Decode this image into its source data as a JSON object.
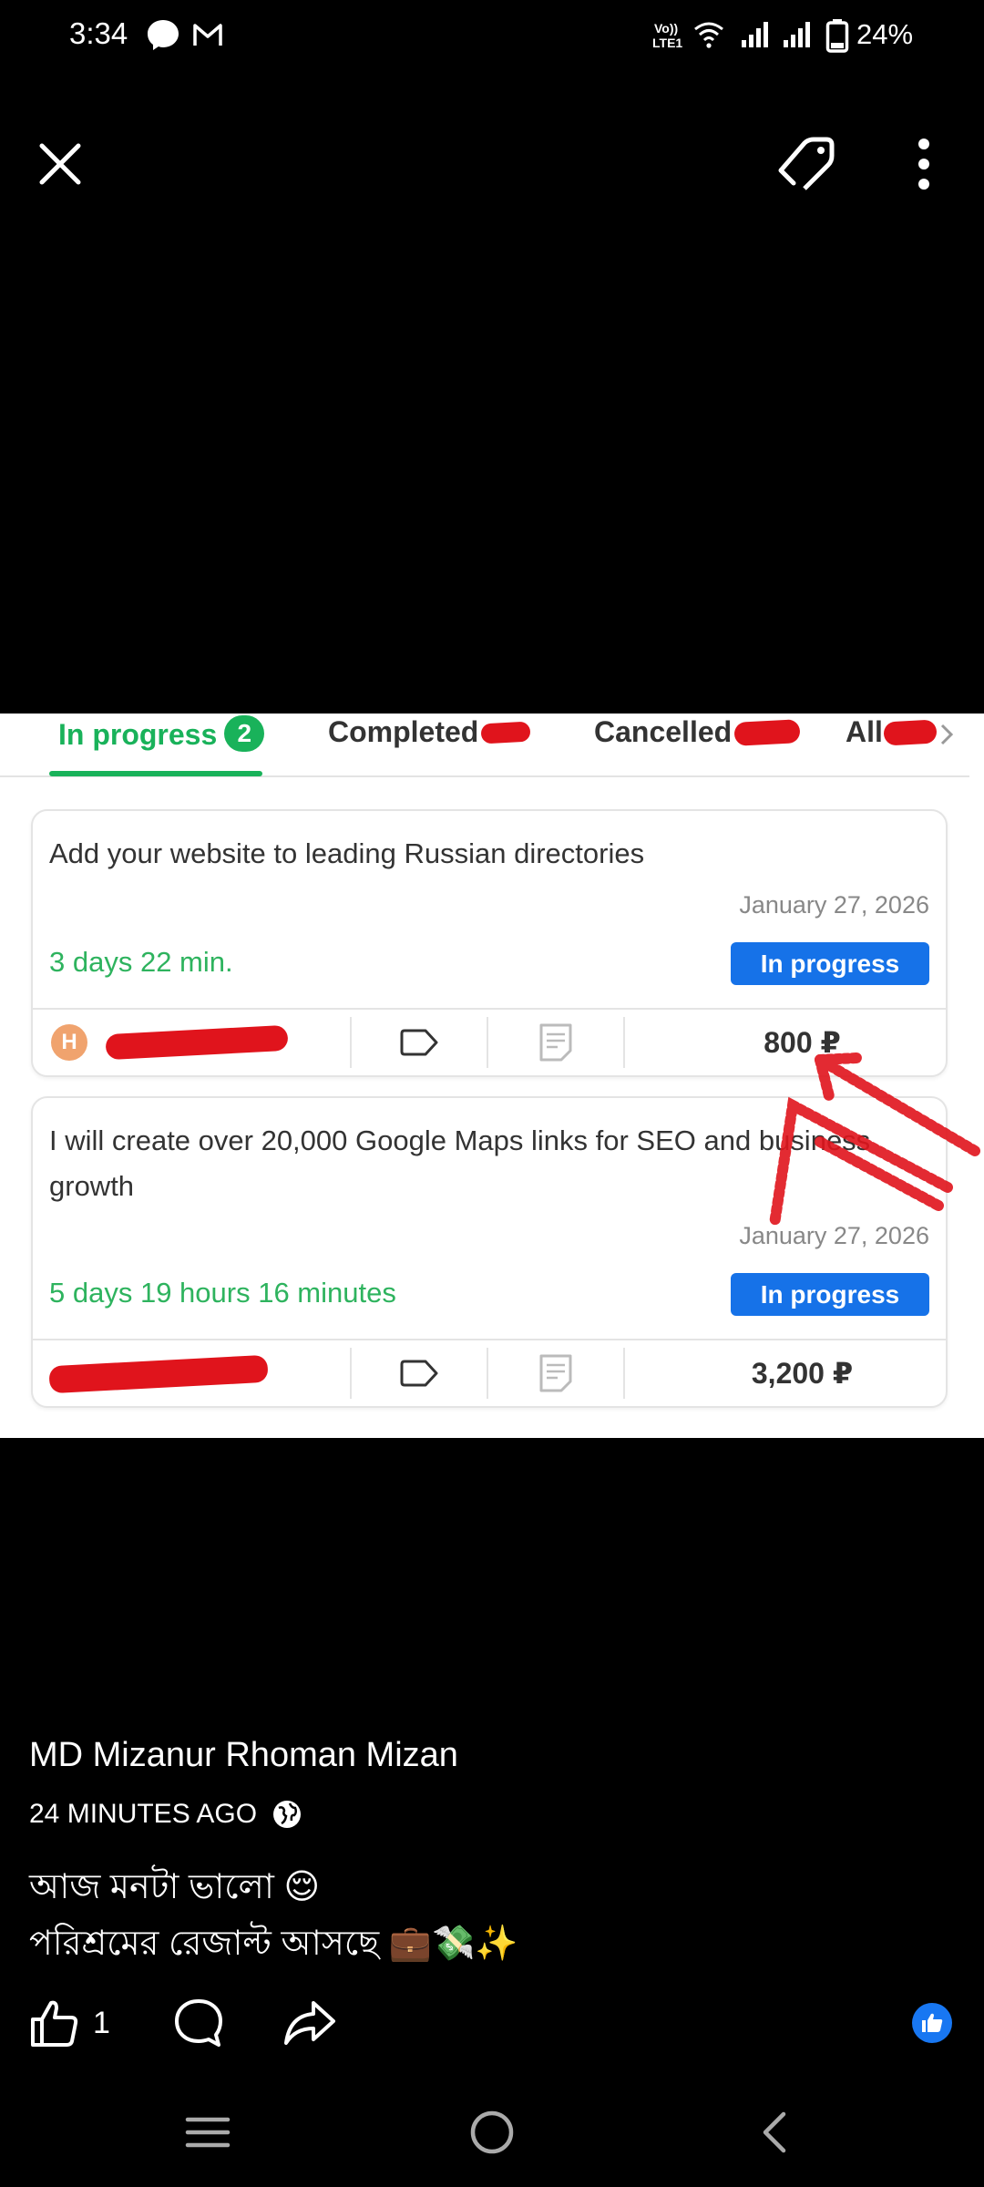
{
  "status_bar": {
    "time": "3:34",
    "battery": "24%",
    "icons": [
      "messenger-icon",
      "gmail-icon",
      "volte-icon",
      "wifi-icon",
      "signal-icon",
      "signal-icon",
      "battery-icon"
    ]
  },
  "viewer": {
    "close_icon": "close-icon",
    "tag_icon": "tag-icon",
    "more_icon": "more-vertical-icon"
  },
  "screenshot": {
    "tabs": [
      {
        "label": "In progress",
        "count": "2",
        "active": true
      },
      {
        "label": "Completed"
      },
      {
        "label": "Cancelled"
      },
      {
        "label": "All"
      }
    ],
    "orders": [
      {
        "title": "Add your website to leading Russian directories",
        "date": "January 27, 2026",
        "timer": "3 days 22 min.",
        "status": "In progress",
        "avatar_letter": "H",
        "price": "800 ₽"
      },
      {
        "title": "I will create over 20,000 Google Maps links for SEO and business growth",
        "date": "January 27, 2026",
        "timer": "5 days 19 hours 16 minutes",
        "status": "In progress",
        "price": "3,200 ₽"
      }
    ]
  },
  "post": {
    "author": "MD Mizanur Rhoman Mizan",
    "time": "24 MINUTES AGO",
    "caption_line1": "আজ মনটা ভালো 😌",
    "caption_line2": "পরিশ্রমের রেজাল্ট আসছে 💼💸✨",
    "like_count": "1"
  },
  "colors": {
    "accent_green": "#19b25a",
    "status_blue": "#1672e8",
    "redaction_red": "#e0141c",
    "fb_blue": "#1877f2"
  }
}
